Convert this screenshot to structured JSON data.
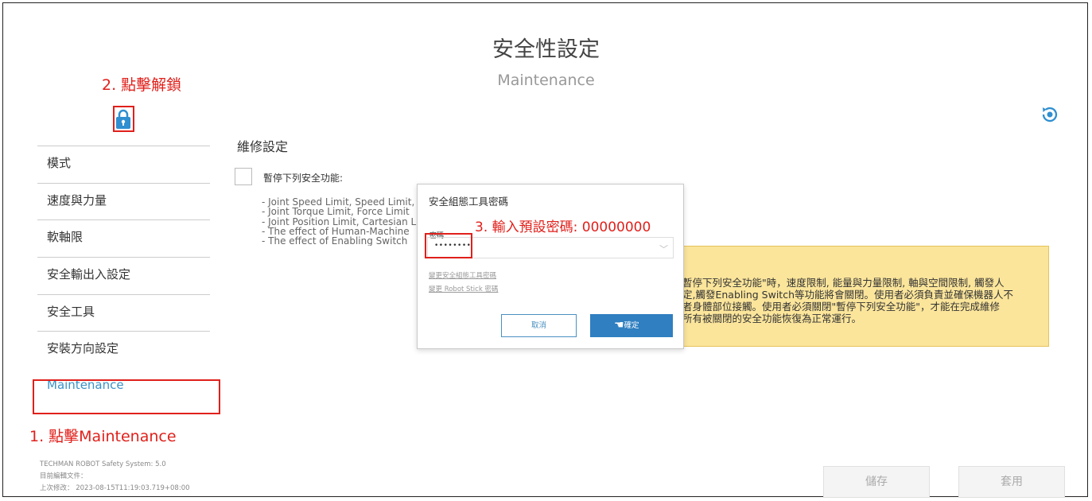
{
  "header": {
    "title": "安全性設定",
    "subtitle": "Maintenance"
  },
  "annotations": {
    "step1": "1. 點擊Maintenance",
    "step2": "2. 點擊解鎖",
    "step3": "3. 輸入預設密碼: 00000000"
  },
  "sidebar": {
    "items": [
      {
        "label": "模式"
      },
      {
        "label": "速度與力量"
      },
      {
        "label": "軟軸限"
      },
      {
        "label": "安全輸出入設定"
      },
      {
        "label": "安全工具"
      },
      {
        "label": "安裝方向設定"
      },
      {
        "label": "Maintenance"
      }
    ]
  },
  "system_info": {
    "version": "TECHMAN ROBOT Safety System:  5.0",
    "current_file": "目前編輯文件：",
    "last_modified": "上次修改：  2023-08-15T11:19:03.719+08:00"
  },
  "main": {
    "section_title": "維修設定",
    "checkbox_label": "暫停下列安全功能:",
    "functions": [
      "- Joint Speed Limit, Speed Limit,",
      "- Joint Torque Limit, Force Limit",
      "- Joint Position Limit, Cartesian L",
      "- The effect of Human-Machine",
      "- The effect of Enabling Switch"
    ],
    "warning_lines": [
      "暫停下列安全功能\"時，速度限制, 能量與力量限制, 軸與空間限制, 觸發人",
      "定,觸發Enabling Switch等功能將會關閉。使用者必須負責並確保機器人不",
      "者身體部位接觸。使用者必須關閉\"暫停下列安全功能\"，才能在完成維修",
      "所有被關閉的安全功能恢復為正常運行。"
    ]
  },
  "dialog": {
    "title": "安全組態工具密碼",
    "password_label": "密碼",
    "password_value": "••••••••",
    "link_change_tool": "變更安全組態工具密碼",
    "link_change_stick": "變更 Robot Stick 密碼",
    "cancel_label": "取消",
    "ok_label": "確定"
  },
  "footer": {
    "save_label": "儲存",
    "apply_label": "套用"
  },
  "colors": {
    "accent": "#2f7fc1",
    "annotation_red": "#e0201b",
    "warning_bg": "#fbe59b",
    "active_link": "#3a92c7"
  }
}
